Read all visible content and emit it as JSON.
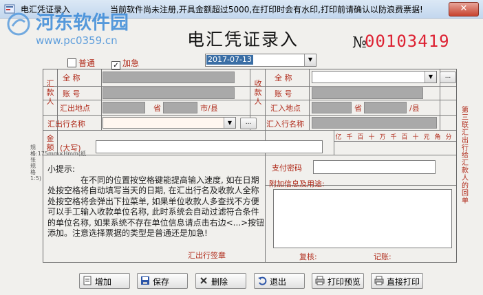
{
  "window": {
    "title": "电汇凭证录入",
    "notice": "当前软件尚未注册,开具金额超过5000,在打印时会有水印,打印前请确认以防浪费票据!",
    "close_label": "✕"
  },
  "watermark": {
    "site_name": "河东软件园",
    "url": "www.pc0359.cn"
  },
  "form": {
    "heading": "电汇凭证录入",
    "no_label": "№",
    "no_value": "00103419",
    "options": {
      "normal": "普通",
      "urgent": "加急",
      "urgent_checked": true
    },
    "date": "2017-07-13",
    "remitter": {
      "group_label": "汇款人",
      "name_label": "全 称",
      "account_label": "账 号",
      "location_label": "汇出地点",
      "province_label": "省",
      "city_label": "市/县",
      "bank_label": "汇出行名称"
    },
    "payee": {
      "group_label": "收款人",
      "name_label": "全 称",
      "account_label": "账 号",
      "location_label": "汇入地点",
      "province_label": "省",
      "city_label": "/县",
      "bank_label": "汇入行名称"
    },
    "amount_label": "金额",
    "amount_caps_label": "(大写)",
    "digit_headers": [
      "亿",
      "千",
      "百",
      "十",
      "万",
      "千",
      "百",
      "十",
      "元",
      "角",
      "分"
    ],
    "pay_password_label": "支付密码",
    "extra_info_label": "附加信息及用途:",
    "review_label": "复核:",
    "bookkeeping_label": "记账:",
    "bank_sign_label": "汇出行签章",
    "ellipsis": "..."
  },
  "tips": {
    "title": "小提示:",
    "body": "在不同的位置按空格键能提高输入速度, 如在日期处按空格将自动填写当天的日期, 在汇出行名及收款人全称处按空格将会弹出下拉菜单, 如果单位收款人多查找不方便可以手工输入收款单位名称, 此时系统会自动过滤符合条件的单位名称, 如果系统不存在单位信息请点击右边<...>按钮添加。注意选择票据的类型是普通还是加急!"
  },
  "side_note": "第三联 汇出行给汇款人的回单",
  "left_note": "规格:175mm×Hmm(纸张规格1:5)",
  "buttons": {
    "add": "增加",
    "save": "保存",
    "delete": "删除",
    "exit": "退出",
    "print_preview": "打印预览",
    "print": "直接打印"
  },
  "colors": {
    "label_red": "#b02a1a",
    "serial_red": "#d22233",
    "watermark_blue": "#3a8ad8",
    "titlebar": "#c3d7ee"
  }
}
